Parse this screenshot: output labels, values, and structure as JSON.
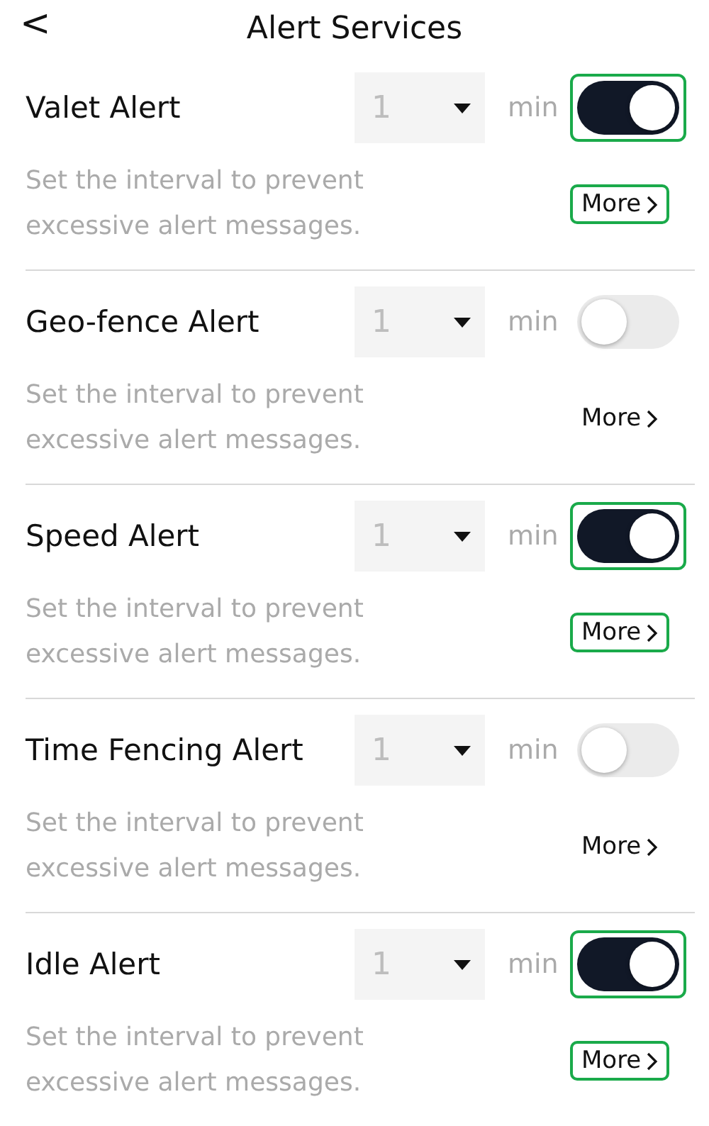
{
  "header": {
    "back": "<",
    "title": "Alert Services"
  },
  "alerts": [
    {
      "name": "Valet Alert",
      "interval": "1",
      "unit": "min",
      "on": true,
      "highlighted": true,
      "description": "Set the interval to prevent excessive alert messages.",
      "more": "More"
    },
    {
      "name": "Geo-fence Alert",
      "interval": "1",
      "unit": "min",
      "on": false,
      "highlighted": false,
      "description": "Set the interval to prevent excessive alert messages.",
      "more": "More"
    },
    {
      "name": "Speed Alert",
      "interval": "1",
      "unit": "min",
      "on": true,
      "highlighted": true,
      "description": "Set the interval to prevent excessive alert messages.",
      "more": "More"
    },
    {
      "name": "Time Fencing Alert",
      "interval": "1",
      "unit": "min",
      "on": false,
      "highlighted": false,
      "description": "Set the interval to prevent excessive alert messages.",
      "more": "More"
    },
    {
      "name": "Idle Alert",
      "interval": "1",
      "unit": "min",
      "on": true,
      "highlighted": true,
      "description": "Set the interval to prevent excessive alert messages.",
      "more": "More"
    }
  ]
}
